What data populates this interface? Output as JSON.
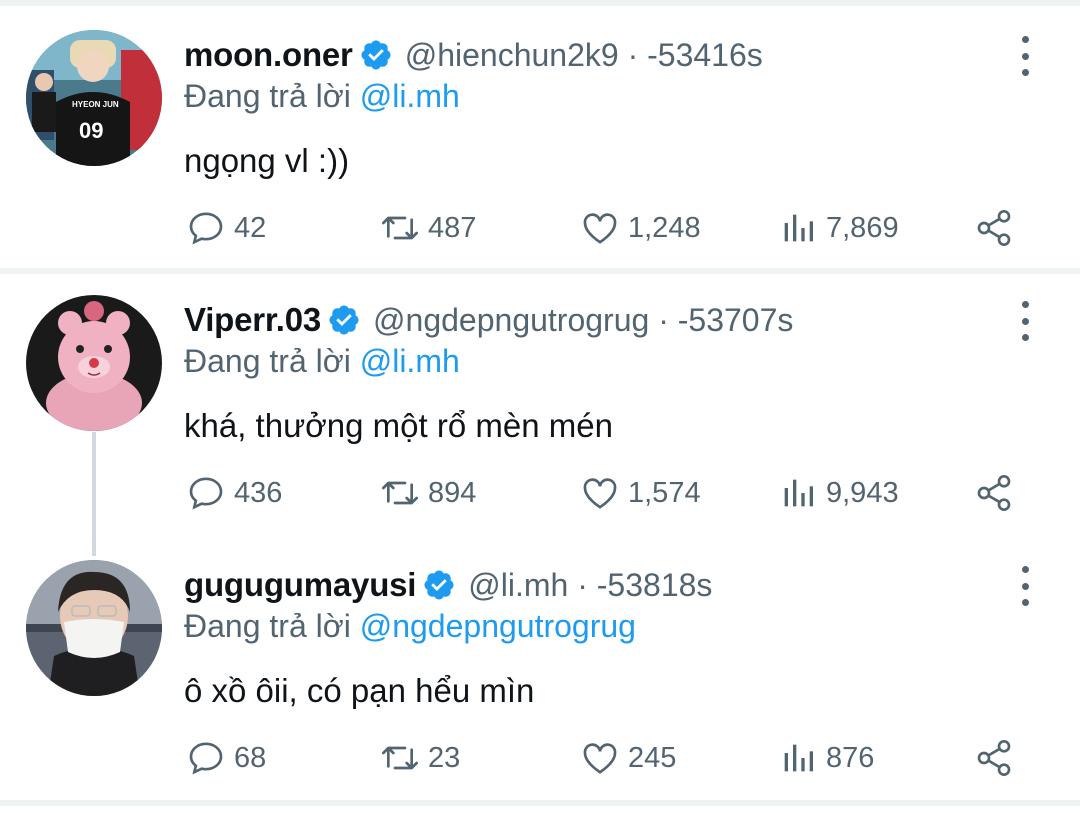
{
  "reply_prefix": "Đang trả lời",
  "tweets": [
    {
      "name": "moon.oner",
      "handle": "@hienchun2k9 · -53416s",
      "reply_to": "@li.mh",
      "text": "ngọng vl :))",
      "stats": {
        "replies": "42",
        "retweets": "487",
        "likes": "1,248",
        "views": "7,869"
      },
      "avatar": "avatar-photo-person-jersey-09",
      "avatar_lettering": "HYEON JUN 09"
    },
    {
      "name": "Viperr.03",
      "handle": "@ngdepngutrogrug · -53707s",
      "reply_to": "@li.mh",
      "text": "khá, thưởng một rổ mèn mén",
      "stats": {
        "replies": "436",
        "retweets": "894",
        "likes": "1,574",
        "views": "9,943"
      },
      "avatar": "avatar-photo-pink-plush-toy"
    },
    {
      "name": "gugugumayusi",
      "handle": "@li.mh · -53818s",
      "reply_to": "@ngdepngutrogrug",
      "text": "ô xồ ôii, có pạn hểu mìn",
      "stats": {
        "replies": "68",
        "retweets": "23",
        "likes": "245",
        "views": "876"
      },
      "avatar": "avatar-photo-person-mask"
    }
  ],
  "icons": [
    "verified-badge-icon",
    "more-options-icon",
    "reply-icon",
    "retweet-icon",
    "like-icon",
    "views-icon",
    "share-icon"
  ],
  "colors": {
    "accent": "#1d9bf0",
    "secondary_text": "#536471",
    "primary_text": "#0f1419",
    "divider": "#eff3f4",
    "thread_line": "#cfd9de"
  }
}
